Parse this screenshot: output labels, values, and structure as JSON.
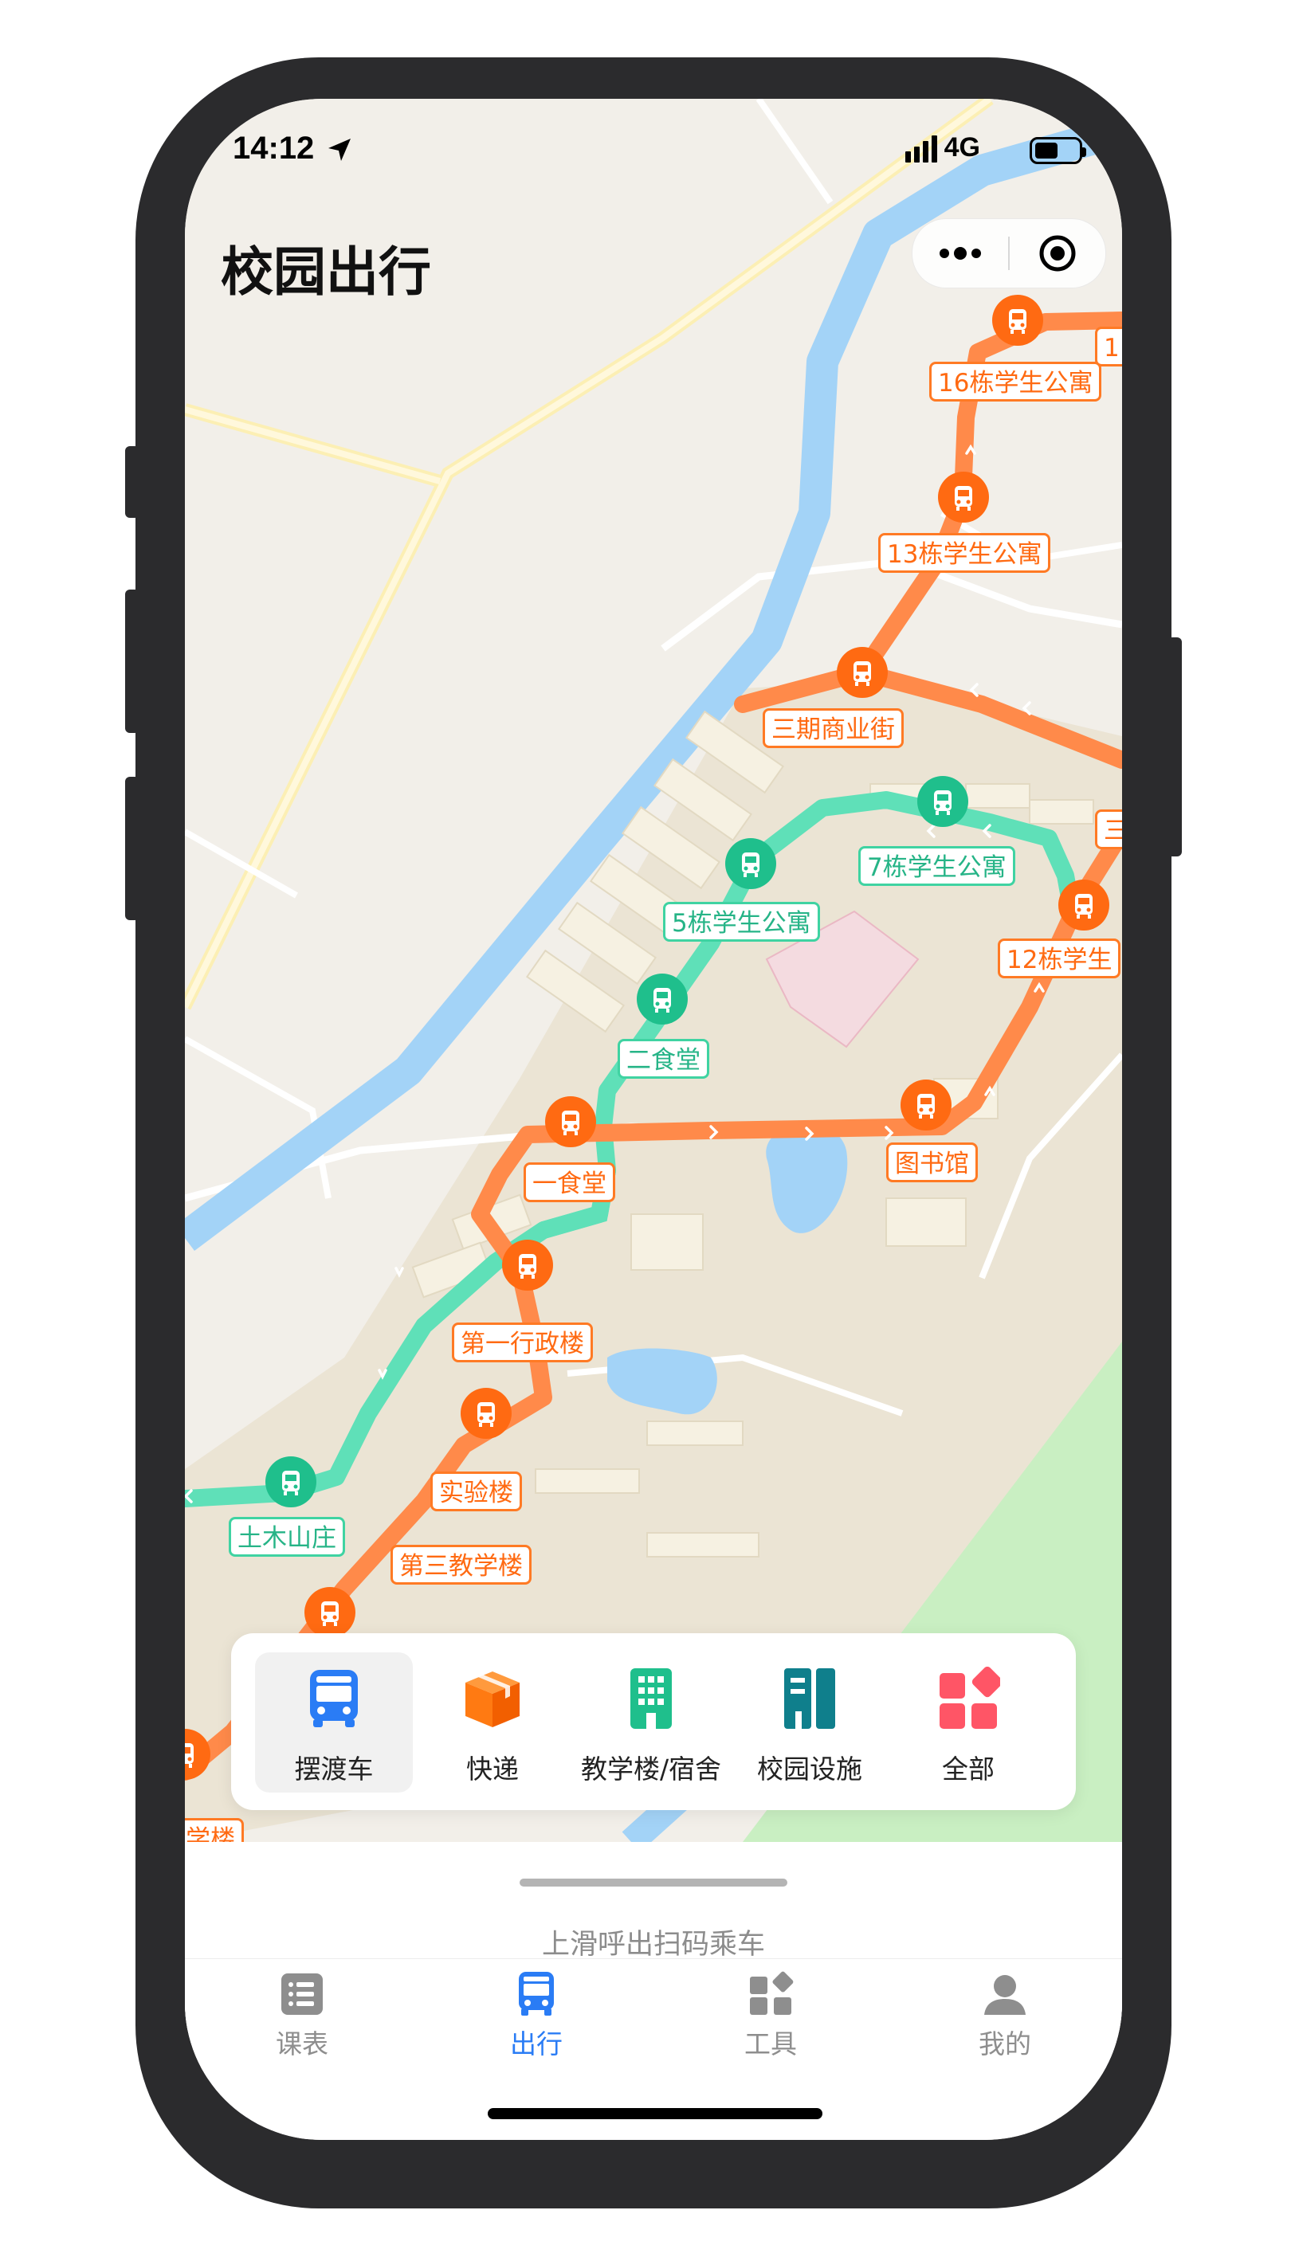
{
  "status_bar": {
    "time": "14:12",
    "network": "4G"
  },
  "header": {
    "title": "校园出行"
  },
  "colors": {
    "orange_route": "#ff8a4a",
    "green_route": "#5fe0b8",
    "accent_blue": "#2a7cf5",
    "river": "#a3d3f7"
  },
  "stops": [
    {
      "name": "16栋学生公寓",
      "route": "orange"
    },
    {
      "name": "13栋学生公寓",
      "route": "orange"
    },
    {
      "name": "三期商业街",
      "route": "orange"
    },
    {
      "name": "7栋学生公寓",
      "route": "green"
    },
    {
      "name": "5栋学生公寓",
      "route": "green"
    },
    {
      "name": "12栋学生",
      "route": "orange"
    },
    {
      "name": "二食堂",
      "route": "green"
    },
    {
      "name": "图书馆",
      "route": "orange"
    },
    {
      "name": "一食堂",
      "route": "orange"
    },
    {
      "name": "第一行政楼",
      "route": "orange"
    },
    {
      "name": "实验楼",
      "route": "orange"
    },
    {
      "name": "土木山庄",
      "route": "green"
    },
    {
      "name": "第三教学楼",
      "route": "orange"
    }
  ],
  "partial_labels": {
    "top_right": "1",
    "mid_right": "三",
    "bottom_left": "学楼"
  },
  "toolbar": {
    "items": [
      {
        "label": "摆渡车",
        "icon": "bus-icon",
        "active": true
      },
      {
        "label": "快递",
        "icon": "package-icon"
      },
      {
        "label": "教学楼/宿舍",
        "icon": "building-icon"
      },
      {
        "label": "校园设施",
        "icon": "facility-icon"
      },
      {
        "label": "全部",
        "icon": "grid-icon"
      }
    ]
  },
  "sheet": {
    "hint": "上滑呼出扫码乘车"
  },
  "tabbar": {
    "items": [
      {
        "label": "课表",
        "icon": "list-icon"
      },
      {
        "label": "出行",
        "icon": "bus-icon",
        "active": true
      },
      {
        "label": "工具",
        "icon": "tools-icon"
      },
      {
        "label": "我的",
        "icon": "profile-icon"
      }
    ]
  }
}
